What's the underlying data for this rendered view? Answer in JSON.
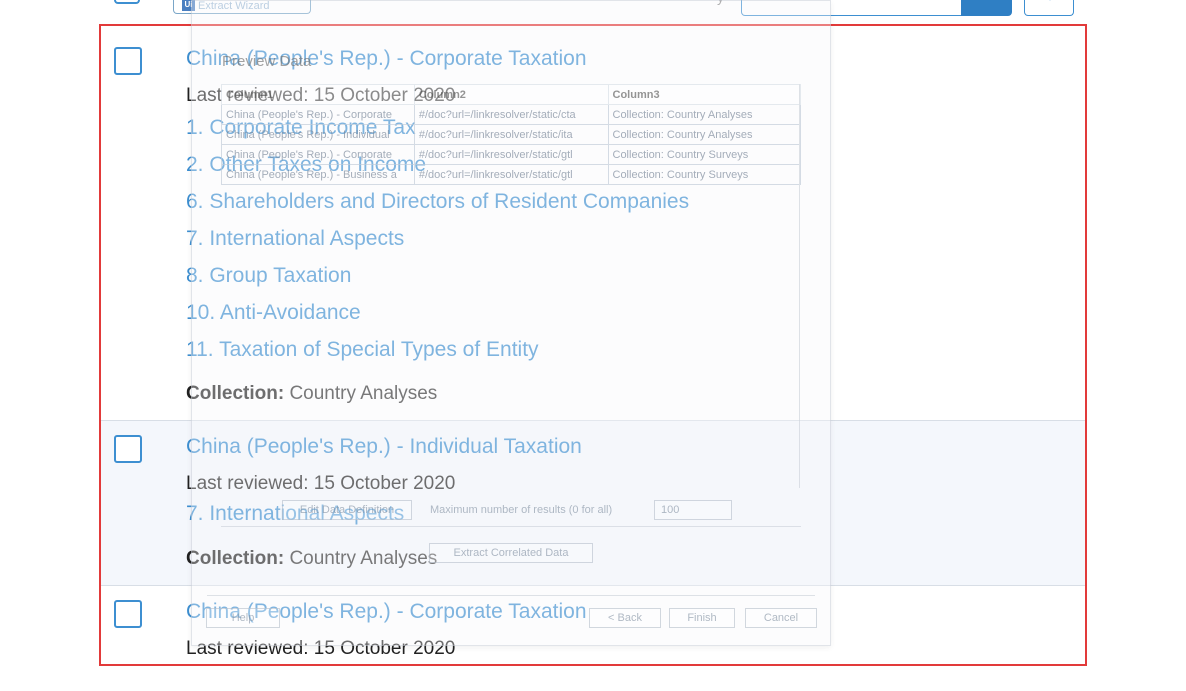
{
  "top": {
    "extract_wizard_label": "Extract Wizard",
    "ui_logo": "Ui",
    "sort_label": "y"
  },
  "results": [
    {
      "title": "China (People's Rep.) - Corporate Taxation",
      "reviewed": "Last reviewed: 15 October 2020",
      "chapters": [
        "1. Corporate Income Tax",
        "2. Other Taxes on Income",
        "6. Shareholders and Directors of Resident Companies",
        "7. International Aspects",
        "8. Group Taxation",
        "10. Anti-Avoidance",
        "11. Taxation of Special Types of Entity"
      ],
      "collection_label": "Collection:",
      "collection_value": " Country Analyses"
    },
    {
      "title": "China (People's Rep.) - Individual Taxation",
      "reviewed": "Last reviewed: 15 October 2020",
      "chapters": [
        "7. International Aspects"
      ],
      "collection_label": "Collection:",
      "collection_value": " Country Analyses"
    },
    {
      "title": "China (People's Rep.) - Corporate Taxation",
      "reviewed": "Last reviewed: 15 October 2020",
      "chapters": [],
      "collection_label": "",
      "collection_value": ""
    }
  ],
  "overlay": {
    "title": "Preview Data",
    "columns": [
      "Column1",
      "Column2",
      "Column3"
    ],
    "rows": [
      [
        "China (People's Rep.) - Corporate",
        "#/doc?url=/linkresolver/static/cta",
        "Collection: Country Analyses"
      ],
      [
        "China (People's Rep.) - Individual",
        "#/doc?url=/linkresolver/static/ita",
        "Collection: Country Analyses"
      ],
      [
        "China (People's Rep.) - Corporate",
        "#/doc?url=/linkresolver/static/gtl",
        "Collection: Country Surveys"
      ],
      [
        "China (People's Rep.) - Business a",
        "#/doc?url=/linkresolver/static/gtl",
        "Collection: Country Surveys"
      ]
    ],
    "edit_button": "Edit Data Definition",
    "max_results_label": "Maximum number of results (0 for all)",
    "max_results_value": "100",
    "correlated_button": "Extract Correlated Data",
    "help_button": "Help",
    "back_button": "< Back",
    "finish_button": "Finish",
    "cancel_button": "Cancel"
  },
  "colors": {
    "link": "#3d8fd1",
    "highlight_border": "#e23a3a",
    "alt_row": "#f4f7fc"
  }
}
